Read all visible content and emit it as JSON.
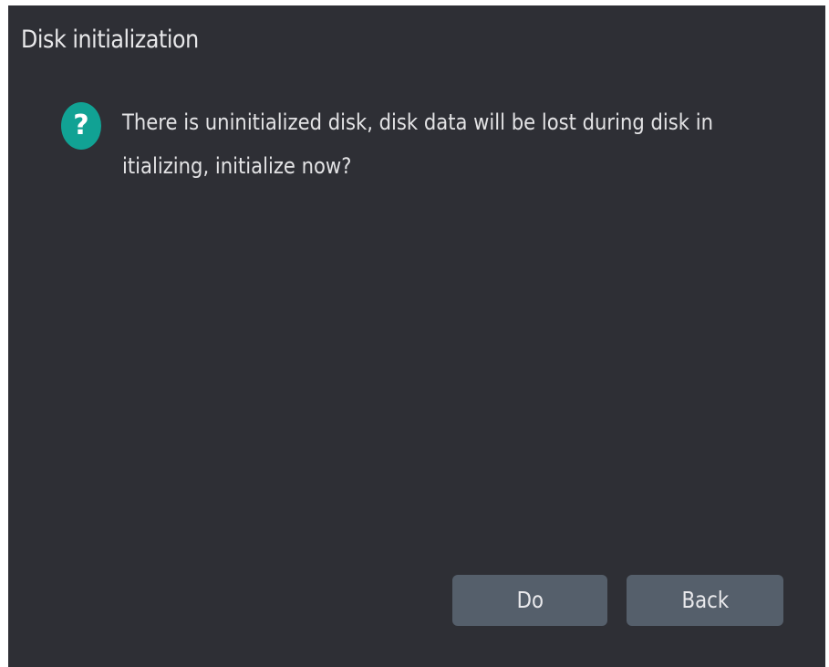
{
  "dialog": {
    "title": "Disk initialization",
    "icon": "question-icon",
    "icon_glyph": "?",
    "icon_color": "#11a294",
    "message": "There is uninitialized disk, disk data will be lost during disk in itializing, initialize now?",
    "buttons": {
      "do_label": "Do",
      "back_label": "Back"
    },
    "background_color": "#2e2f35",
    "button_color": "#555f6b"
  }
}
